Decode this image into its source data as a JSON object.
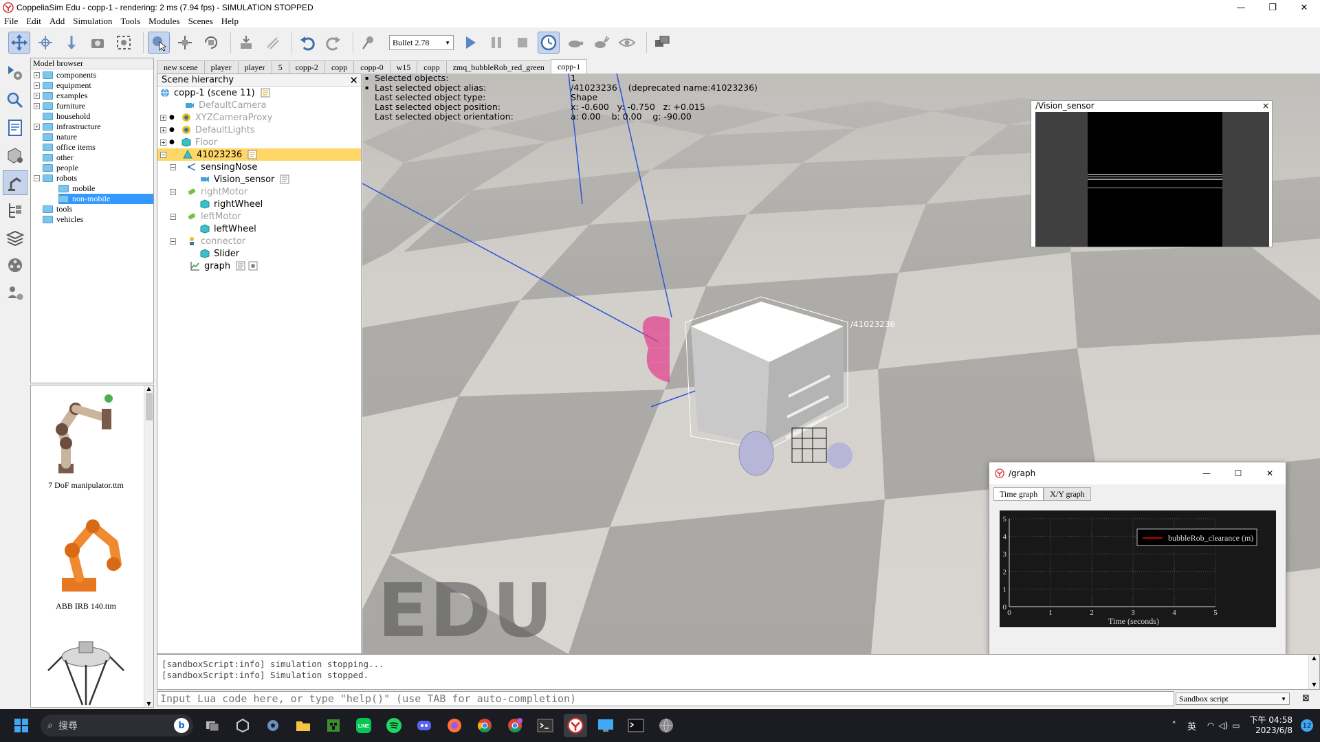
{
  "window": {
    "title": "CoppeliaSim Edu - copp-1 - rendering: 2 ms (7.94 fps) - SIMULATION STOPPED",
    "controls": [
      "—",
      "❐",
      "✕"
    ]
  },
  "menu": [
    "File",
    "Edit",
    "Add",
    "Simulation",
    "Tools",
    "Modules",
    "Scenes",
    "Help"
  ],
  "toolbar": {
    "engine": "Bullet 2.78"
  },
  "model_browser": {
    "header": "Model browser",
    "folders": [
      {
        "label": "components",
        "expandable": true
      },
      {
        "label": "equipment",
        "expandable": true
      },
      {
        "label": "examples",
        "expandable": true
      },
      {
        "label": "furniture",
        "expandable": true
      },
      {
        "label": "household",
        "expandable": false
      },
      {
        "label": "infrastructure",
        "expandable": true
      },
      {
        "label": "nature",
        "expandable": false
      },
      {
        "label": "office items",
        "expandable": false
      },
      {
        "label": "other",
        "expandable": false
      },
      {
        "label": "people",
        "expandable": false
      },
      {
        "label": "robots",
        "expandable": true
      },
      {
        "label": "mobile",
        "expandable": false
      },
      {
        "label": "non-mobile",
        "expandable": false
      },
      {
        "label": "tools",
        "expandable": false
      },
      {
        "label": "vehicles",
        "expandable": false
      }
    ],
    "thumbnails": [
      "7 DoF manipulator.ttm",
      "ABB IRB 140.ttm"
    ]
  },
  "scene_tabs": [
    "new scene",
    "player",
    "player",
    "5",
    "copp-2",
    "copp",
    "copp-0",
    "w15",
    "copp",
    "zmq_bubbleRob_red_green",
    "copp-1"
  ],
  "scene_hierarchy": {
    "header": "Scene hierarchy",
    "root": "copp-1 (scene 11)",
    "items": [
      {
        "label": "DefaultCamera",
        "greyed": true
      },
      {
        "label": "XYZCameraProxy",
        "greyed": true
      },
      {
        "label": "DefaultLights",
        "greyed": true
      },
      {
        "label": "Floor",
        "greyed": true
      },
      {
        "label": "41023236",
        "greyed": false
      },
      {
        "label": "sensingNose",
        "greyed": false
      },
      {
        "label": "Vision_sensor",
        "greyed": false
      },
      {
        "label": "rightMotor",
        "greyed": true
      },
      {
        "label": "rightWheel",
        "greyed": false
      },
      {
        "label": "leftMotor",
        "greyed": true
      },
      {
        "label": "leftWheel",
        "greyed": false
      },
      {
        "label": "connector",
        "greyed": true
      },
      {
        "label": "Slider",
        "greyed": false
      },
      {
        "label": "graph",
        "greyed": false
      }
    ]
  },
  "selection_info": {
    "rows": [
      {
        "key": "Selected objects:",
        "value": "1"
      },
      {
        "key": "Last selected object alias:",
        "value": "/41023236    (deprecated name:41023236)"
      },
      {
        "key": "Last selected object type:",
        "value": "Shape"
      },
      {
        "key": "Last selected object position:",
        "value": "x: -0.600   y: -0.750   z: +0.015"
      },
      {
        "key": "Last selected object orientation:",
        "value": "a: 0.00    b: 0.00    g: -90.00"
      }
    ]
  },
  "viewport": {
    "object_label": "/41023236",
    "watermark": "EDU"
  },
  "vision_window": {
    "title": "/Vision_sensor",
    "close": "×"
  },
  "graph_window": {
    "title": "/graph",
    "tabs": [
      "Time graph",
      "X/Y graph"
    ]
  },
  "chart_data": {
    "type": "line",
    "series": [
      {
        "name": "bubbleRob_clearance (m)",
        "x": [],
        "y": []
      }
    ],
    "xlabel": "Time (seconds)",
    "ylabel": "",
    "xlim": [
      0,
      5
    ],
    "ylim": [
      0,
      5
    ],
    "xticks": [
      "0",
      "1",
      "2",
      "3",
      "4",
      "5"
    ],
    "yticks": [
      "0",
      "1",
      "2",
      "3",
      "4",
      "5"
    ],
    "series_color": "#ff0000",
    "background": "#000000",
    "legend_position": "top-right",
    "grid": true
  },
  "console": {
    "lines": [
      "[sandboxScript:info] simulation stopping...",
      "[sandboxScript:info] Simulation stopped."
    ]
  },
  "lua_input": {
    "placeholder": "Input Lua code here, or type \"help()\" (use TAB for auto-completion)"
  },
  "script_selector": "Sandbox script",
  "taskbar": {
    "search_placeholder": "搜尋",
    "tray_lang": "英",
    "time": "下午 04:58",
    "date": "2023/6/8",
    "notification_count": "12"
  }
}
